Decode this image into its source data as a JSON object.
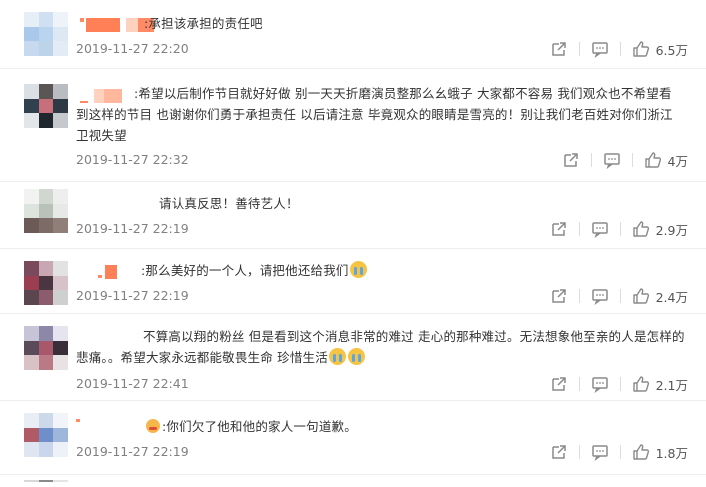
{
  "comments": [
    {
      "name_suffix": ":",
      "text": "承担该承担的责任吧",
      "time": "2019-11-27 22:20",
      "likes": "6.5万"
    },
    {
      "name_suffix": ":",
      "text": "希望以后制作节目就好好做 别一天天折磨演员整那么幺蛾子 大家都不容易 我们观众也不希望看到这样的节目 也谢谢你们勇于承担责任 以后请注意 毕竟观众的眼睛是雪亮的！别让我们老百姓对你们浙江卫视失望",
      "time": "2019-11-27 22:32",
      "likes": "4万"
    },
    {
      "name_suffix": "",
      "text": "请认真反思！善待艺人！",
      "time": "2019-11-27 22:19",
      "likes": "2.9万"
    },
    {
      "name_suffix": ":",
      "text": "那么美好的一个人，请把他还给我们",
      "time": "2019-11-27 22:19",
      "likes": "2.4万"
    },
    {
      "name_suffix": "",
      "text": "不算高以翔的粉丝 但是看到这个消息非常的难过 走心的那种难过。无法想象他至亲的人是怎样的悲痛。。希望大家永远都能敬畏生命 珍惜生活",
      "time": "2019-11-27 22:41",
      "likes": "2.1万"
    },
    {
      "name_suffix": ":",
      "text": "你们欠了他和他的家人一句道歉。",
      "time": "2019-11-27 22:19",
      "likes": "1.8万"
    }
  ],
  "icons": {
    "forward": "share-icon",
    "comment": "comment-icon",
    "like": "thumbs-up-icon",
    "emoji_cry": "crying-emoji-icon",
    "emoji_angry": "angry-emoji-icon"
  },
  "colors": {
    "text": "#333333",
    "meta": "#808080",
    "icon": "#8a8a8a",
    "mosaic_accent": "#ff8a65"
  }
}
